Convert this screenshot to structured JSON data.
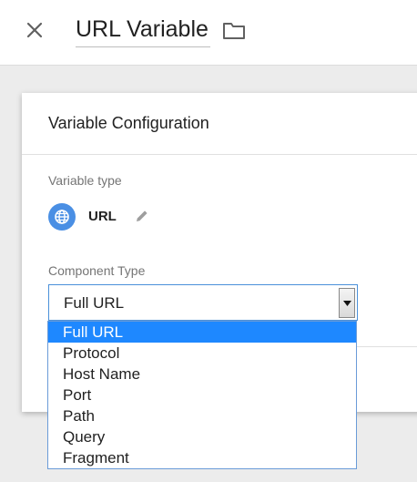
{
  "header": {
    "title": "URL Variable"
  },
  "card": {
    "title": "Variable Configuration",
    "variable_type_label": "Variable type",
    "variable_type_value": "URL",
    "component_type_label": "Component Type"
  },
  "select": {
    "value": "Full URL",
    "options": [
      "Full URL",
      "Protocol",
      "Host Name",
      "Port",
      "Path",
      "Query",
      "Fragment"
    ],
    "selected_index": 0
  },
  "colors": {
    "accent": "#4a8fe4",
    "selected_option": "#1e88ff"
  },
  "icons": [
    "close-icon",
    "folder-icon",
    "globe-icon",
    "pencil-icon",
    "dropdown-arrow-icon"
  ]
}
